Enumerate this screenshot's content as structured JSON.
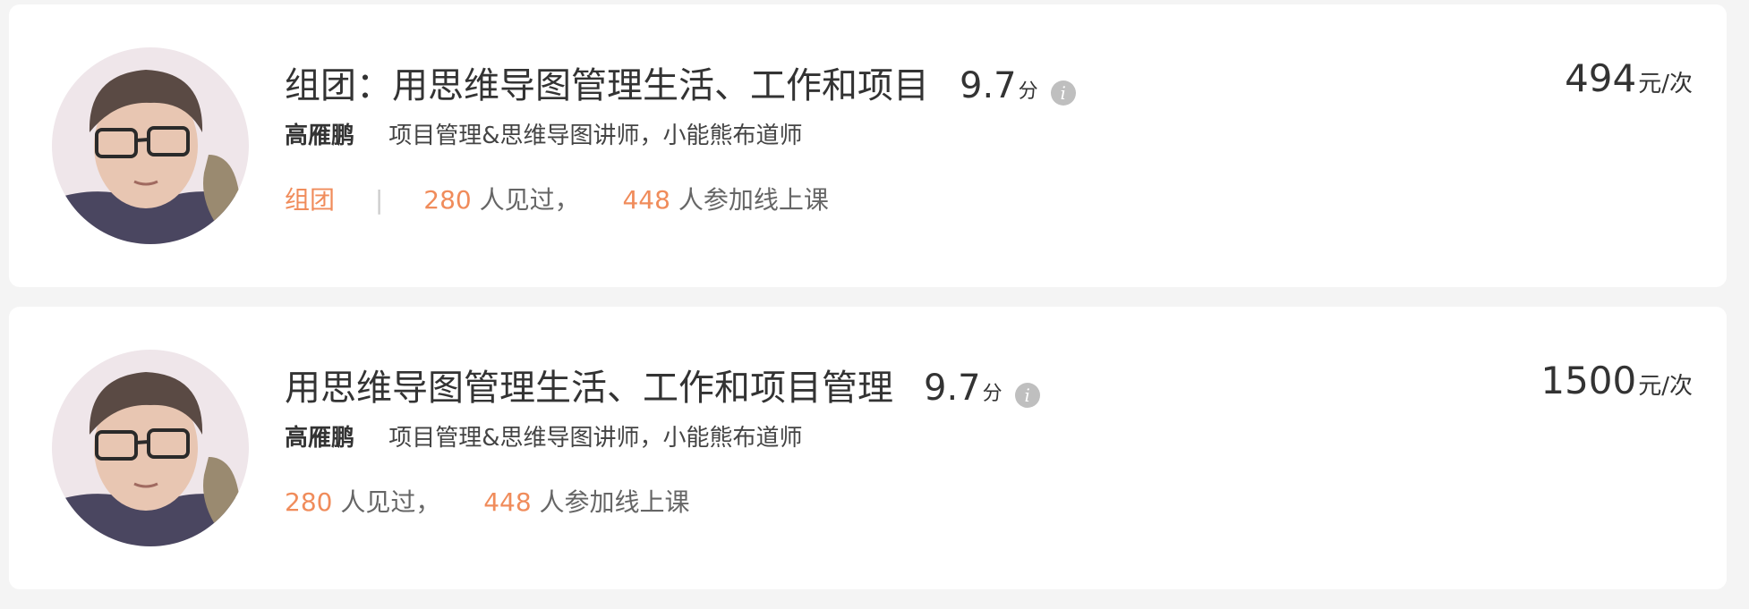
{
  "courses": [
    {
      "title": "组团：用思维导图管理生活、工作和项目",
      "score": "9.7",
      "score_unit": "分",
      "teacher_name": "高雁鹏",
      "teacher_desc": "项目管理&思维导图讲师，小能熊布道师",
      "tag": "组团",
      "tag_separator": "|",
      "met_count": "280",
      "met_suffix": "人见过，",
      "joined_count": "448",
      "joined_suffix": "人参加线上课",
      "price": "494",
      "price_unit": "元/次"
    },
    {
      "title": "用思维导图管理生活、工作和项目管理",
      "score": "9.7",
      "score_unit": "分",
      "teacher_name": "高雁鹏",
      "teacher_desc": "项目管理&思维导图讲师，小能熊布道师",
      "met_count": "280",
      "met_suffix": "人见过，",
      "joined_count": "448",
      "joined_suffix": "人参加线上课",
      "price": "1500",
      "price_unit": "元/次"
    }
  ],
  "info_icon_glyph": "i",
  "colors": {
    "accent": "#f08c5b",
    "text": "#333333",
    "muted": "#666666",
    "card_bg": "#ffffff",
    "page_bg": "#f4f4f4",
    "icon_bg": "#bfbfbf"
  }
}
